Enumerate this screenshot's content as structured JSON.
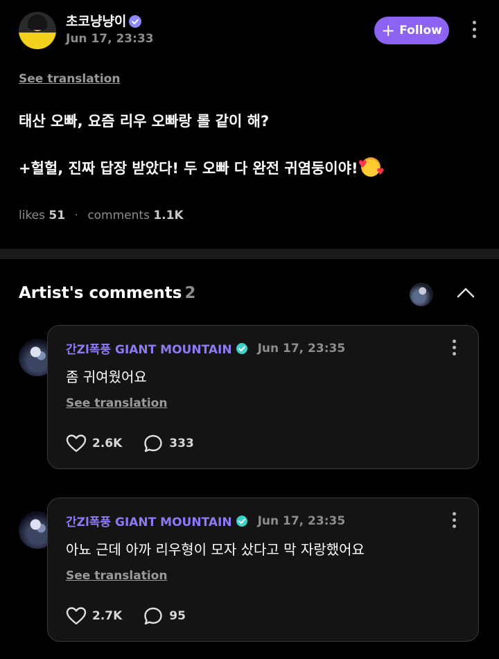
{
  "post": {
    "author": "초코냥냥이",
    "time": "Jun 17, 23:33",
    "follow_label": "Follow",
    "see_translation": "See translation",
    "line1": "태산 오빠, 요즘 리우 오빠랑 롤 같이 해?",
    "line2": "+헐헐, 진짜 답장 받았다! 두 오빠 다 완전 귀염둥이야!",
    "likes_label": "likes",
    "likes_count": "51",
    "comments_label": "comments",
    "comments_count": "1.1K"
  },
  "artist_comments": {
    "title": "Artist's comments",
    "count": "2"
  },
  "comments": [
    {
      "author": "간Zl폭풍 GIANT MOUNTAIN",
      "time": "Jun 17, 23:35",
      "text": "좀 귀여웠어요",
      "see_translation": "See translation",
      "likes": "2.6K",
      "replies": "333"
    },
    {
      "author": "간Zl폭풍 GIANT MOUNTAIN",
      "time": "Jun 17, 23:35",
      "text": "아뇨 근데 아까 리우형이 모자 샀다고 막 자랑했어요",
      "see_translation": "See translation",
      "likes": "2.7K",
      "replies": "95"
    }
  ],
  "colors": {
    "accent": "#8c63f3",
    "name_purple": "#8d7af5",
    "verified_teal": "#3fd1c8",
    "muted": "#8d8d8d"
  },
  "icons": [
    "verified-icon",
    "plus-icon",
    "more-icon",
    "chevron-up-icon",
    "heart-icon",
    "comment-bubble-icon",
    "smiling-face-with-hearts-emoji"
  ]
}
